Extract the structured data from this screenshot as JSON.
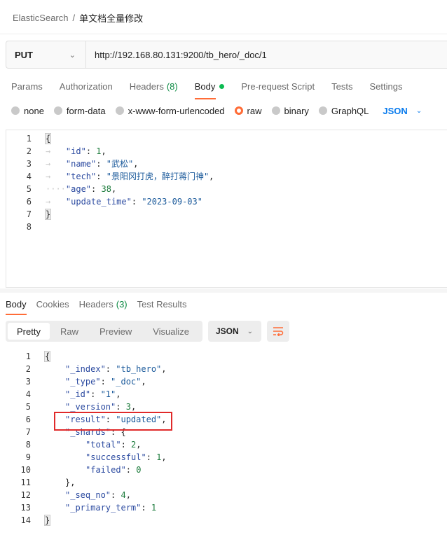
{
  "breadcrumb": {
    "parent": "ElasticSearch",
    "separator": "/",
    "current": "单文档全量修改"
  },
  "request": {
    "method": "PUT",
    "url": "http://192.168.80.131:9200/tb_hero/_doc/1",
    "tabs": [
      {
        "label": "Params"
      },
      {
        "label": "Authorization"
      },
      {
        "label": "Headers",
        "count": "(8)"
      },
      {
        "label": "Body",
        "active": true
      },
      {
        "label": "Pre-request Script"
      },
      {
        "label": "Tests"
      },
      {
        "label": "Settings"
      }
    ],
    "body_types": [
      "none",
      "form-data",
      "x-www-form-urlencoded",
      "raw",
      "binary",
      "GraphQL"
    ],
    "body_type_selected": "raw",
    "body_format": "JSON",
    "body_lines": [
      {
        "n": "1"
      },
      {
        "n": "2",
        "key": "\"id\"",
        "num": "1",
        "end": ","
      },
      {
        "n": "3",
        "key": "\"name\"",
        "str": "\"武松\"",
        "end": ","
      },
      {
        "n": "4",
        "key": "\"tech\"",
        "str": "\"景阳冈打虎，醉打蒋门神\"",
        "end": ","
      },
      {
        "n": "5",
        "key": "\"age\"",
        "num": "38",
        "end": ","
      },
      {
        "n": "6",
        "key": "\"update_time\"",
        "str": "\"2023-09-03\""
      },
      {
        "n": "7"
      },
      {
        "n": "8"
      }
    ]
  },
  "response": {
    "tabs": [
      {
        "label": "Body",
        "active": true
      },
      {
        "label": "Cookies"
      },
      {
        "label": "Headers",
        "count": "(3)"
      },
      {
        "label": "Test Results"
      }
    ],
    "views": [
      "Pretty",
      "Raw",
      "Preview",
      "Visualize"
    ],
    "view_selected": "Pretty",
    "format": "JSON",
    "lines": [
      {
        "n": "1"
      },
      {
        "n": "2",
        "key": "\"_index\"",
        "str": "\"tb_hero\"",
        "end": ","
      },
      {
        "n": "3",
        "key": "\"_type\"",
        "str": "\"_doc\"",
        "end": ","
      },
      {
        "n": "4",
        "key": "\"_id\"",
        "str": "\"1\"",
        "end": ","
      },
      {
        "n": "5",
        "key": "\"_version\"",
        "num": "3",
        "end": ","
      },
      {
        "n": "6",
        "key": "\"result\"",
        "str": "\"updated\"",
        "end": ","
      },
      {
        "n": "7",
        "key": "\"_shards\"",
        "end": ": {"
      },
      {
        "n": "8",
        "key": "\"total\"",
        "num": "2",
        "end": ","
      },
      {
        "n": "9",
        "key": "\"successful\"",
        "num": "1",
        "end": ","
      },
      {
        "n": "10",
        "key": "\"failed\"",
        "num": "0"
      },
      {
        "n": "11",
        "end": "},"
      },
      {
        "n": "12",
        "key": "\"_seq_no\"",
        "num": "4",
        "end": ","
      },
      {
        "n": "13",
        "key": "\"_primary_term\"",
        "num": "1"
      },
      {
        "n": "14"
      }
    ]
  },
  "colors": {
    "accent": "#ff6c37",
    "highlight_box": "#e02a2a",
    "json_link": "#097bed"
  },
  "icons": {
    "method_chevron": "chevron-down-icon",
    "wrap": "wrap-lines-icon"
  }
}
